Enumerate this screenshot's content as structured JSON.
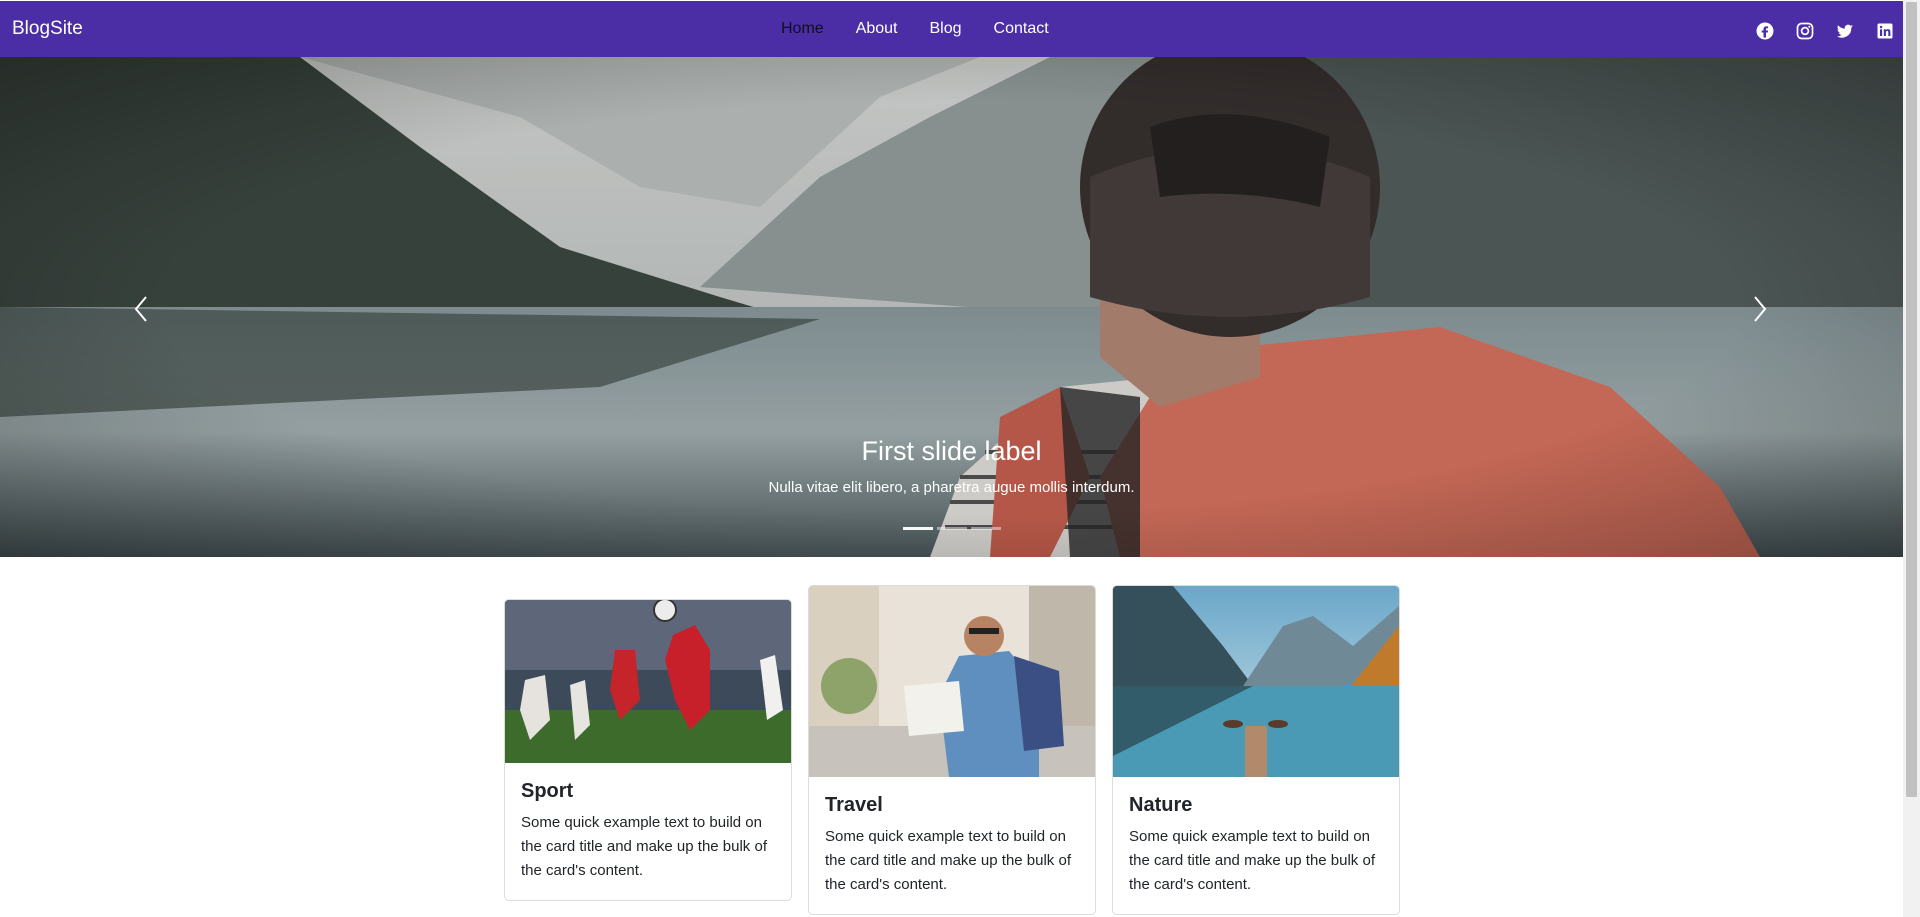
{
  "colors": {
    "brand": "#4b2ea6",
    "nav_active": "#101010",
    "text": "#212529"
  },
  "navbar": {
    "brand": "BlogSite",
    "links": [
      {
        "label": "Home",
        "active": true
      },
      {
        "label": "About",
        "active": false
      },
      {
        "label": "Blog",
        "active": false
      },
      {
        "label": "Contact",
        "active": false
      }
    ],
    "social_icons": [
      "facebook-icon",
      "instagram-icon",
      "twitter-icon",
      "linkedin-icon"
    ]
  },
  "hero": {
    "slide_title": "First slide label",
    "slide_text": "Nulla vitae elit libero, a pharetra augue mollis interdum.",
    "indicator_count": 3,
    "active_indicator": 1,
    "prev_icon": "chevron-left-icon",
    "next_icon": "chevron-right-icon"
  },
  "cards": [
    {
      "title": "Sport",
      "text": "Some quick example text to build on the card title and make up the bulk of the card's content."
    },
    {
      "title": "Travel",
      "text": "Some quick example text to build on the card title and make up the bulk of the card's content."
    },
    {
      "title": "Nature",
      "text": "Some quick example text to build on the card title and make up the bulk of the card's content."
    }
  ]
}
